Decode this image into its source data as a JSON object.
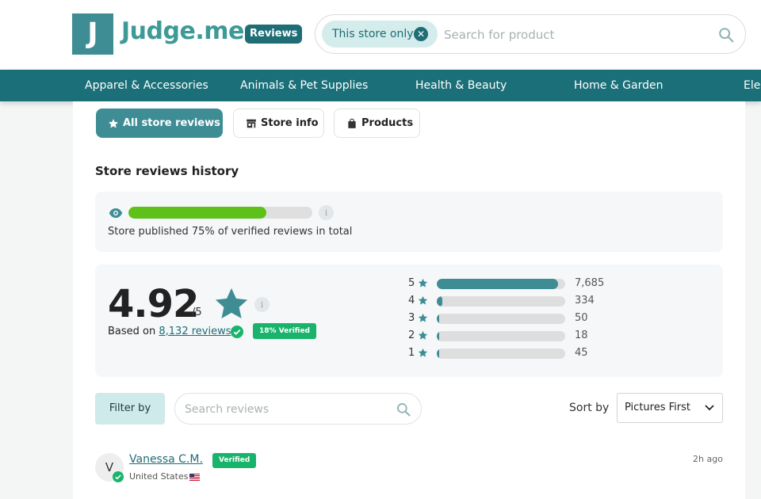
{
  "header": {
    "logo_letter": "J",
    "logo_text": "Judge.me",
    "reviews_badge": "Reviews",
    "search": {
      "chip_label": "This store only",
      "placeholder": "Search for product"
    }
  },
  "nav": {
    "items": [
      "Apparel & Accessories",
      "Animals & Pet Supplies",
      "Health & Beauty",
      "Home & Garden",
      "Ele"
    ]
  },
  "tabs": [
    {
      "label": "All store reviews",
      "icon": "star-icon",
      "active": true
    },
    {
      "label": "Store info",
      "icon": "store-icon",
      "active": false
    },
    {
      "label": "Products",
      "icon": "bag-icon",
      "active": false
    }
  ],
  "history": {
    "title": "Store reviews history",
    "published_fraction": 0.75,
    "published_text": "Store published 75% of verified reviews in total"
  },
  "summary": {
    "rating": "4.92",
    "out_of": "/5",
    "based_on_prefix": "Based on",
    "reviews_link": "8,132 reviews",
    "verified_pct": "18% Verified",
    "info": "i",
    "histogram": [
      {
        "stars": "5",
        "count": "7,685",
        "fraction": 0.945
      },
      {
        "stars": "4",
        "count": "334",
        "fraction": 0.041
      },
      {
        "stars": "3",
        "count": "50",
        "fraction": 0.006
      },
      {
        "stars": "2",
        "count": "18",
        "fraction": 0.002
      },
      {
        "stars": "1",
        "count": "45",
        "fraction": 0.006
      }
    ]
  },
  "filters": {
    "filter_label": "Filter by",
    "search_placeholder": "Search reviews",
    "sort_label": "Sort by",
    "sort_value": "Pictures First"
  },
  "review": {
    "avatar_initial": "V",
    "name": "Vanessa C.M.",
    "verified": "Verified",
    "country": "United States",
    "time": "2h ago"
  },
  "colors": {
    "brand": "#3e8d95",
    "nav": "#1a6f78",
    "published": "#5ec11a",
    "verified": "#19b46c"
  }
}
